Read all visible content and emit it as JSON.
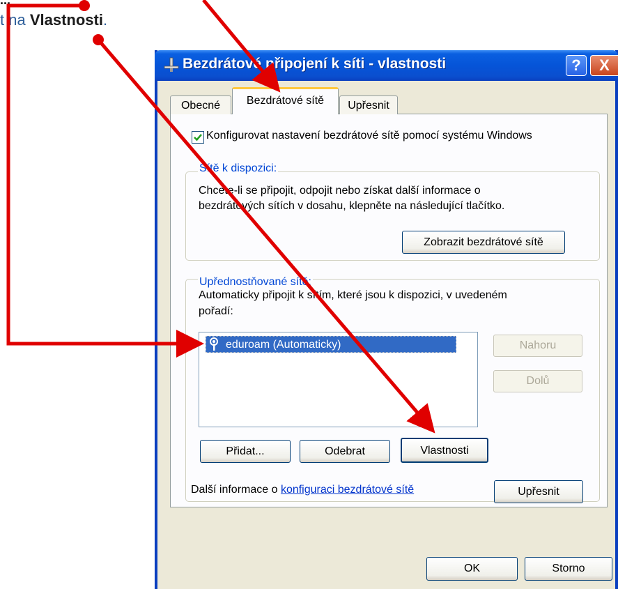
{
  "instruction": {
    "top_cut": "...",
    "prefix": "t na ",
    "bold": "Vlastnosti",
    "suffix": "."
  },
  "window": {
    "title": "Bezdrátové připojení k síti - vlastnosti",
    "help_label": "?",
    "close_label": "X"
  },
  "tabs": [
    {
      "label": "Obecné",
      "active": false
    },
    {
      "label": "Bezdrátové sítě",
      "active": true
    },
    {
      "label": "Upřesnit",
      "active": false
    }
  ],
  "config_checkbox": {
    "label": "Konfigurovat nastavení bezdrátové sítě pomocí systému Windows",
    "checked": true
  },
  "available": {
    "title": "Sítě k dispozici:",
    "text_line1": "Chcete-li se připojit, odpojit nebo získat další informace o",
    "text_line2": "bezdrátových sítích v dosahu, klepněte na následující tlačítko.",
    "view_button": "Zobrazit bezdrátové sítě"
  },
  "preferred": {
    "title": "Upřednostňované sítě:",
    "text_line1": "Automaticky připojit k sítím, které jsou k dispozici, v uvedeném",
    "text_line2": "pořadí:",
    "networks": [
      {
        "label": "eduroam (Automaticky)",
        "selected": true
      }
    ],
    "up_button": "Nahoru",
    "down_button": "Dolů",
    "add_button": "Přidat...",
    "remove_button": "Odebrat",
    "properties_button": "Vlastnosti",
    "more_info_prefix": "Další informace o ",
    "more_info_link": "konfiguraci bezdrátové sítě",
    "advanced_button": "Upřesnit"
  },
  "footer": {
    "ok_button": "OK",
    "cancel_button": "Storno"
  },
  "colors": {
    "annotation": "#e00000",
    "titlebar": "#0654d8",
    "selection": "#316ac5"
  }
}
